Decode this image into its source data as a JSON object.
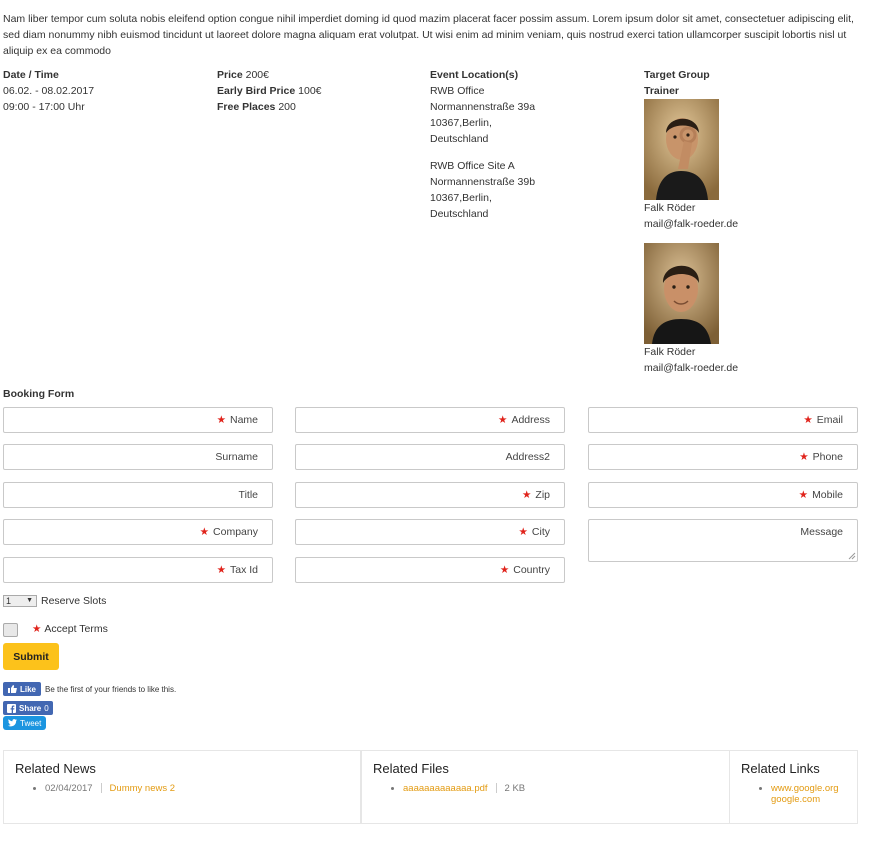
{
  "intro": "Nam liber tempor cum soluta nobis eleifend option congue nihil imperdiet doming id quod mazim placerat facer possim assum. Lorem ipsum dolor sit amet, consectetuer adipiscing elit, sed diam nonummy nibh euismod tincidunt ut laoreet dolore magna aliquam erat volutpat. Ut wisi enim ad minim veniam, quis nostrud exerci tation ullamcorper suscipit lobortis nisl ut aliquip ex ea commodo",
  "event": {
    "datetime_label": "Date / Time",
    "date": "06.02. - 08.02.2017",
    "time": "09:00 - 17:00 Uhr",
    "price_label": "Price",
    "price": "200€",
    "early_label": "Early Bird Price",
    "early_price": "100€",
    "free_label": "Free Places",
    "free_places": "200",
    "location_label": "Event Location(s)",
    "locations": [
      {
        "name": "RWB Office",
        "street": "Normannenstraße 39a",
        "city": "10367,Berlin,",
        "country": "Deutschland"
      },
      {
        "name": "RWB Office Site A",
        "street": "Normannenstraße 39b",
        "city": "10367,Berlin,",
        "country": "Deutschland"
      }
    ],
    "target_label": "Target Group",
    "trainer_label": "Trainer",
    "trainers": [
      {
        "name": "Falk Röder",
        "email": "mail@falk-roeder.de"
      },
      {
        "name": "Falk Röder",
        "email": "mail@falk-roeder.de"
      }
    ]
  },
  "form": {
    "title": "Booking Form",
    "fields": {
      "name": "Name",
      "surname": "Surname",
      "title": "Title",
      "company": "Company",
      "tax_id": "Tax Id",
      "address": "Address",
      "address2": "Address2",
      "zip": "Zip",
      "city": "City",
      "country": "Country",
      "email": "Email",
      "phone": "Phone",
      "mobile": "Mobile",
      "message": "Message"
    },
    "slots_value": "1",
    "slots_label": "Reserve Slots",
    "terms_label": "Accept Terms",
    "submit": "Submit",
    "required_color": "#e0231b",
    "accent_color": "#fcc21b"
  },
  "social": {
    "like": "Like",
    "like_text": "Be the first of your friends to like this.",
    "share": "Share",
    "share_count": "0",
    "tweet": "Tweet"
  },
  "related": {
    "news_title": "Related News",
    "news": [
      {
        "date": "02/04/2017",
        "title": "Dummy news 2"
      }
    ],
    "files_title": "Related Files",
    "files": [
      {
        "name": "aaaaaaaaaaaaa.pdf",
        "size": "2 KB"
      }
    ],
    "links_title": "Related Links",
    "links": [
      "www.google.org",
      "google.com"
    ]
  }
}
